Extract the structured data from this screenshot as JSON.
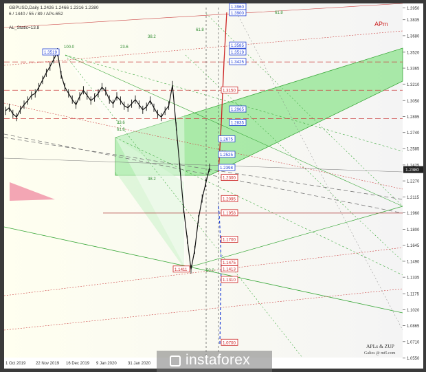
{
  "header": {
    "line1": "GBPUSD,Daily  1.2426 1.2466 1.2316 1.2380",
    "line2": "6 / 1440 / 55 / 89 / APs-652",
    "line3": "AL_Static=13.8"
  },
  "apm_label": "APm",
  "watermark": "instaforex",
  "credit": {
    "line1": "APLs & ZUP",
    "line2": "Galios @ mt5.com"
  },
  "colors": {
    "green_fill": "#8fe48f",
    "red": "#cc2222",
    "blue": "#1f3fd6",
    "apm": "#cc2222"
  },
  "chart_data": {
    "type": "line",
    "title": "GBPUSD,Daily",
    "ylim": [
      1.0555,
      1.3953
    ],
    "y_ticks": [
      "1.3950",
      "1.3835",
      "1.3680",
      "1.3520",
      "1.3365",
      "1.3210",
      "1.3050",
      "1.2895",
      "1.2740",
      "1.2585",
      "1.2425",
      "1.2270",
      "1.2115",
      "1.1960",
      "1.1800",
      "1.1645",
      "1.1490",
      "1.1335",
      "1.1175",
      "1.1020",
      "1.0865",
      "1.0710",
      "1.0550"
    ],
    "current_price": "1.2380",
    "x_ticks": [
      "1 Oct 2019",
      "22 Nov 2019",
      "16 Dec 2019",
      "9 Jan 2020",
      "31 Jan 2020"
    ],
    "levels_blue": [
      "1.3960",
      "1.3900",
      "1.3585",
      "1.3519",
      "1.3425",
      "1.2965",
      "1.2835",
      "1.2675",
      "1.2525",
      "1.2398"
    ],
    "levels_red": [
      "1.3150",
      "1.2300",
      "1.2095",
      "1.1958",
      "1.1700",
      "1.1475",
      "1.1413",
      "1.1310",
      "1.0700"
    ],
    "swing_high_label": "1.3519",
    "swing_low_label": "1.1411",
    "fib_labels_diag": [
      "61.8",
      "38.2",
      "23.6",
      "61.8",
      "100.0",
      "50.0",
      "38.2",
      "23.6",
      "61.8"
    ],
    "price_series": [
      1.295,
      1.298,
      1.292,
      1.289,
      1.296,
      1.301,
      1.305,
      1.31,
      1.312,
      1.318,
      1.325,
      1.332,
      1.338,
      1.345,
      1.3519,
      1.33,
      1.318,
      1.312,
      1.306,
      1.301,
      1.309,
      1.315,
      1.31,
      1.305,
      1.308,
      1.312,
      1.318,
      1.314,
      1.306,
      1.302,
      1.309,
      1.305,
      1.3,
      1.298,
      1.302,
      1.306,
      1.301,
      1.296,
      1.299,
      1.305,
      1.298,
      1.292,
      1.289,
      1.295,
      1.3,
      1.32,
      1.28,
      1.24,
      1.2,
      1.17,
      1.1411,
      1.16,
      1.19,
      1.21,
      1.225,
      1.2398
    ]
  }
}
